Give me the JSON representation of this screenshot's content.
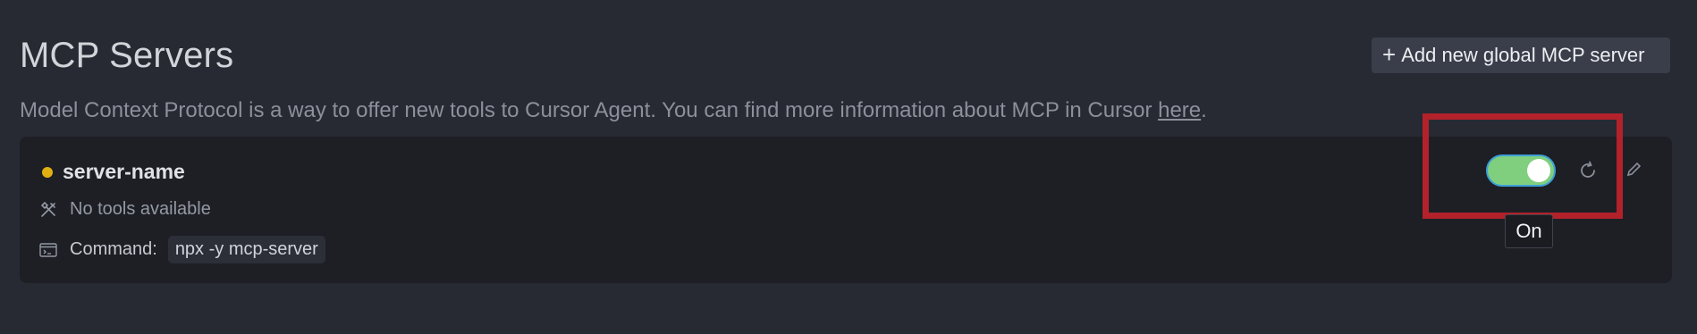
{
  "header": {
    "title": "MCP Servers",
    "add_button_label": "Add new global MCP server",
    "add_button_icon": "plus-icon"
  },
  "description": {
    "text": "Model Context Protocol is a way to offer new tools to Cursor Agent. You can find more information about MCP in Cursor ",
    "link_text": "here",
    "suffix": "."
  },
  "server": {
    "name": "server-name",
    "status_color": "#e0b012",
    "tools_text": "No tools available",
    "command_label": "Command:",
    "command_value": "npx -y mcp-server",
    "enabled": true,
    "toggle_tooltip": "On"
  },
  "colors": {
    "background": "#272a33",
    "card": "#1d1f25",
    "toggle_on": "#7fcf7f",
    "toggle_focus_ring": "#3d9fd6",
    "highlight": "#b3212b"
  }
}
